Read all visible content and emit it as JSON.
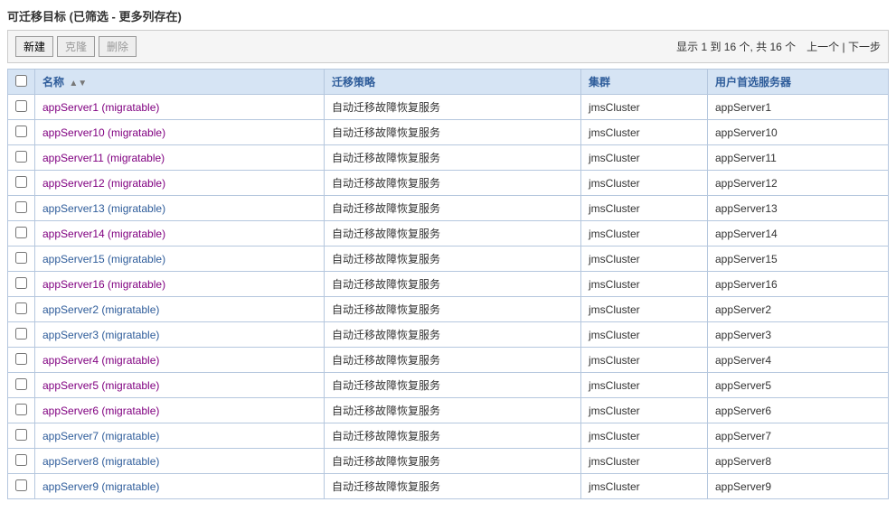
{
  "title": "可迁移目标 (已筛选 - 更多列存在)",
  "toolbar": {
    "new_label": "新建",
    "clone_label": "克隆",
    "delete_label": "删除"
  },
  "pager": {
    "info": "显示 1 到 16 个, 共 16 个",
    "prev": "上一个",
    "sep": " | ",
    "next": "下一步"
  },
  "headers": {
    "name": "名称",
    "strategy": "迁移策略",
    "cluster": "集群",
    "userpref": "用户首选服务器"
  },
  "rows": [
    {
      "name": "appServer1 (migratable)",
      "visited": true,
      "strategy": "自动迁移故障恢复服务",
      "cluster": "jmsCluster",
      "pref": "appServer1"
    },
    {
      "name": "appServer10 (migratable)",
      "visited": true,
      "strategy": "自动迁移故障恢复服务",
      "cluster": "jmsCluster",
      "pref": "appServer10"
    },
    {
      "name": "appServer11 (migratable)",
      "visited": true,
      "strategy": "自动迁移故障恢复服务",
      "cluster": "jmsCluster",
      "pref": "appServer11"
    },
    {
      "name": "appServer12 (migratable)",
      "visited": true,
      "strategy": "自动迁移故障恢复服务",
      "cluster": "jmsCluster",
      "pref": "appServer12"
    },
    {
      "name": "appServer13 (migratable)",
      "visited": false,
      "strategy": "自动迁移故障恢复服务",
      "cluster": "jmsCluster",
      "pref": "appServer13"
    },
    {
      "name": "appServer14 (migratable)",
      "visited": true,
      "strategy": "自动迁移故障恢复服务",
      "cluster": "jmsCluster",
      "pref": "appServer14"
    },
    {
      "name": "appServer15 (migratable)",
      "visited": false,
      "strategy": "自动迁移故障恢复服务",
      "cluster": "jmsCluster",
      "pref": "appServer15"
    },
    {
      "name": "appServer16 (migratable)",
      "visited": true,
      "strategy": "自动迁移故障恢复服务",
      "cluster": "jmsCluster",
      "pref": "appServer16"
    },
    {
      "name": "appServer2 (migratable)",
      "visited": false,
      "strategy": "自动迁移故障恢复服务",
      "cluster": "jmsCluster",
      "pref": "appServer2"
    },
    {
      "name": "appServer3 (migratable)",
      "visited": false,
      "strategy": "自动迁移故障恢复服务",
      "cluster": "jmsCluster",
      "pref": "appServer3"
    },
    {
      "name": "appServer4 (migratable)",
      "visited": true,
      "strategy": "自动迁移故障恢复服务",
      "cluster": "jmsCluster",
      "pref": "appServer4"
    },
    {
      "name": "appServer5 (migratable)",
      "visited": true,
      "strategy": "自动迁移故障恢复服务",
      "cluster": "jmsCluster",
      "pref": "appServer5"
    },
    {
      "name": "appServer6 (migratable)",
      "visited": true,
      "strategy": "自动迁移故障恢复服务",
      "cluster": "jmsCluster",
      "pref": "appServer6"
    },
    {
      "name": "appServer7 (migratable)",
      "visited": false,
      "strategy": "自动迁移故障恢复服务",
      "cluster": "jmsCluster",
      "pref": "appServer7"
    },
    {
      "name": "appServer8 (migratable)",
      "visited": false,
      "strategy": "自动迁移故障恢复服务",
      "cluster": "jmsCluster",
      "pref": "appServer8"
    },
    {
      "name": "appServer9 (migratable)",
      "visited": false,
      "strategy": "自动迁移故障恢复服务",
      "cluster": "jmsCluster",
      "pref": "appServer9"
    }
  ]
}
